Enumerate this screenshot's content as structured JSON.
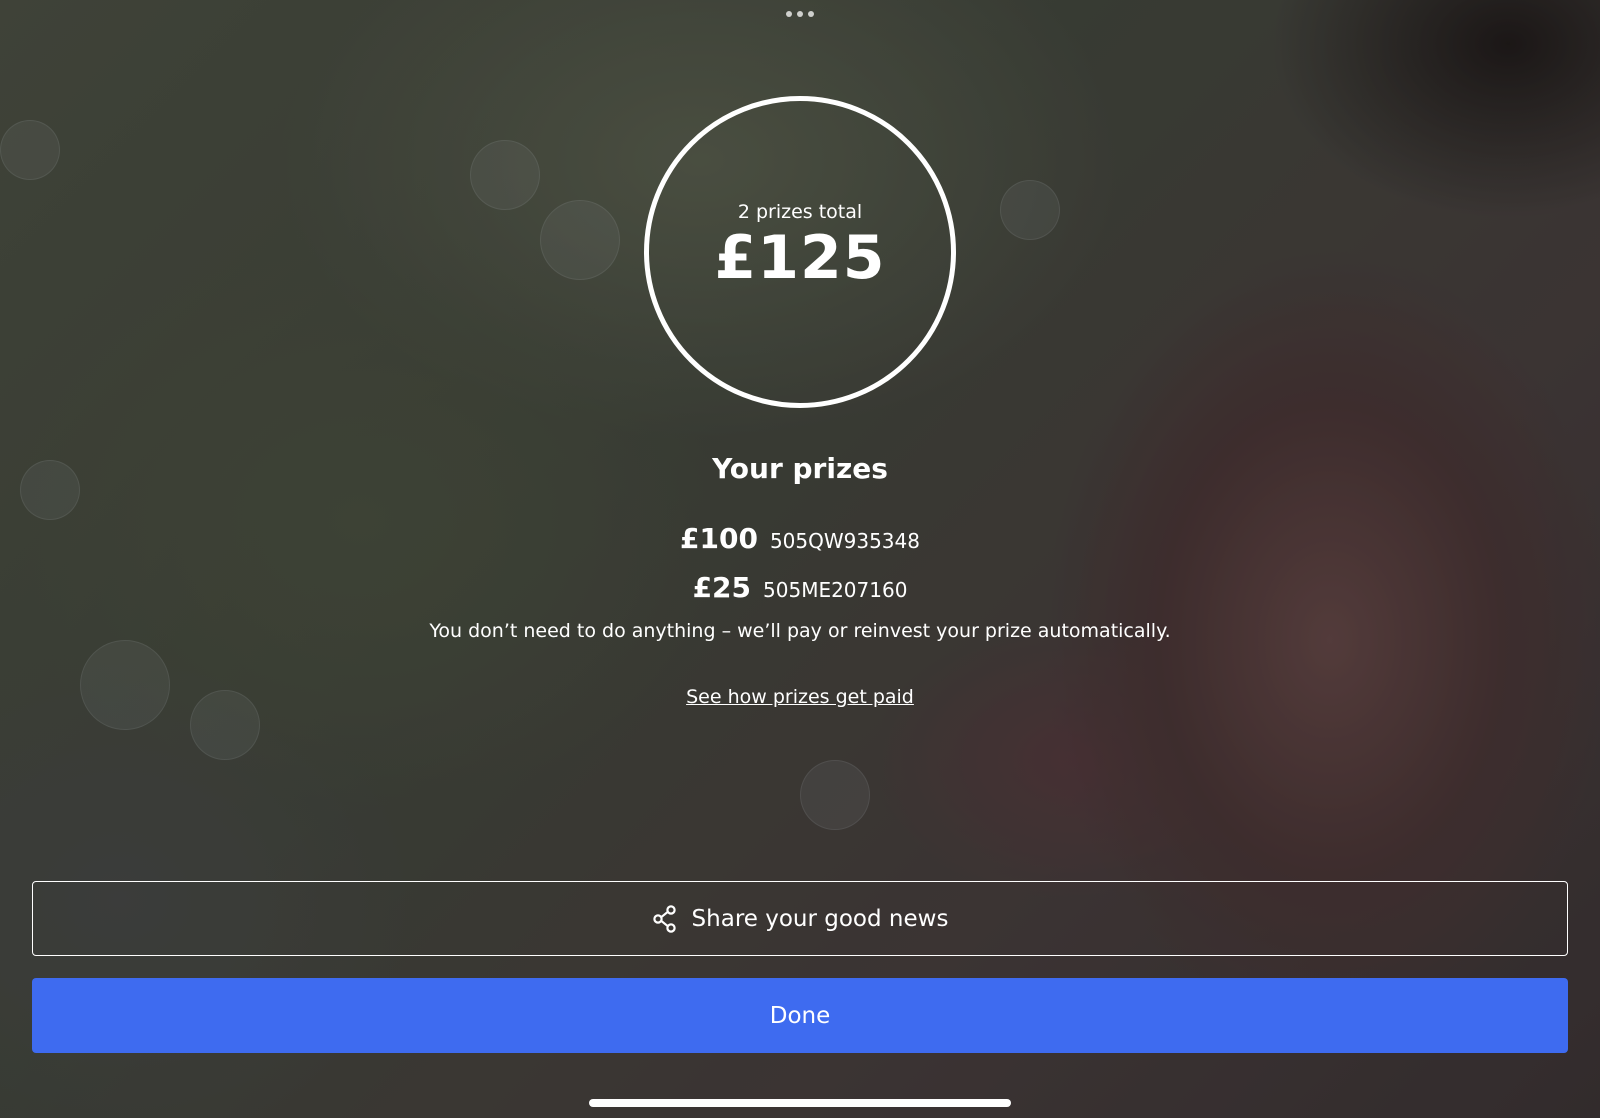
{
  "summary": {
    "caption": "2 prizes total",
    "total": "£125"
  },
  "prizes": {
    "title": "Your prizes",
    "items": [
      {
        "amount": "£100",
        "code": "505QW935348"
      },
      {
        "amount": "£25",
        "code": "505ME207160"
      }
    ],
    "note": "You don’t need to do anything – we’ll pay or reinvest your prize automatically.",
    "link_label": "See how prizes get paid"
  },
  "actions": {
    "share_label": "Share your good news",
    "share_icon": "share-icon",
    "done_label": "Done",
    "done_color": "#3e6bf0"
  }
}
